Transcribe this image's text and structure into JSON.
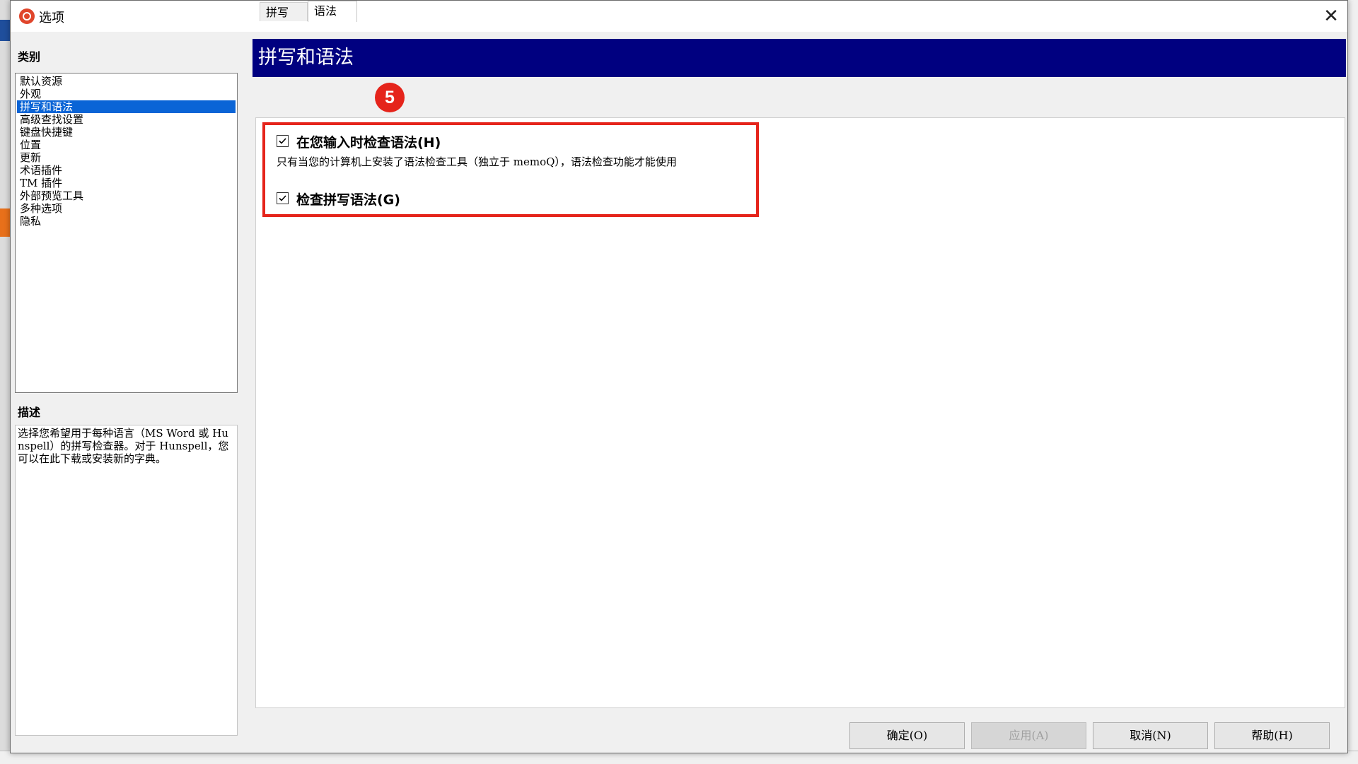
{
  "window": {
    "title": "选项",
    "close_icon": "close-icon"
  },
  "categories": {
    "heading": "类别",
    "items": [
      {
        "label": "默认资源",
        "selected": false
      },
      {
        "label": "外观",
        "selected": false
      },
      {
        "label": "拼写和语法",
        "selected": true
      },
      {
        "label": "高级查找设置",
        "selected": false
      },
      {
        "label": "键盘快捷键",
        "selected": false
      },
      {
        "label": "位置",
        "selected": false
      },
      {
        "label": "更新",
        "selected": false
      },
      {
        "label": "术语插件",
        "selected": false
      },
      {
        "label": "TM 插件",
        "selected": false
      },
      {
        "label": "外部预览工具",
        "selected": false
      },
      {
        "label": "多种选项",
        "selected": false
      },
      {
        "label": "隐私",
        "selected": false
      }
    ]
  },
  "description": {
    "heading": "描述",
    "text": "选择您希望用于每种语言（MS Word 或 Hunspell）的拼写检查器。对于 Hunspell，您可以在此下载或安装新的字典。"
  },
  "main": {
    "header": "拼写和语法",
    "tabs": [
      {
        "label": "拼写",
        "active": false
      },
      {
        "label": "语法",
        "active": true
      }
    ],
    "annotation_badge": "5",
    "options": [
      {
        "label": "在您输入时检查语法(H)",
        "checked": true
      },
      {
        "label": "检查拼写语法(G)",
        "checked": true
      }
    ],
    "note": "只有当您的计算机上安装了语法检查工具（独立于 memoQ），语法检查功能才能使用"
  },
  "buttons": {
    "ok": "确定(O)",
    "apply": "应用(A)",
    "cancel": "取消(N)",
    "help": "帮助(H)"
  },
  "colors": {
    "header_bg": "#000080",
    "selection": "#0a64d6",
    "highlight": "#e5241b"
  }
}
